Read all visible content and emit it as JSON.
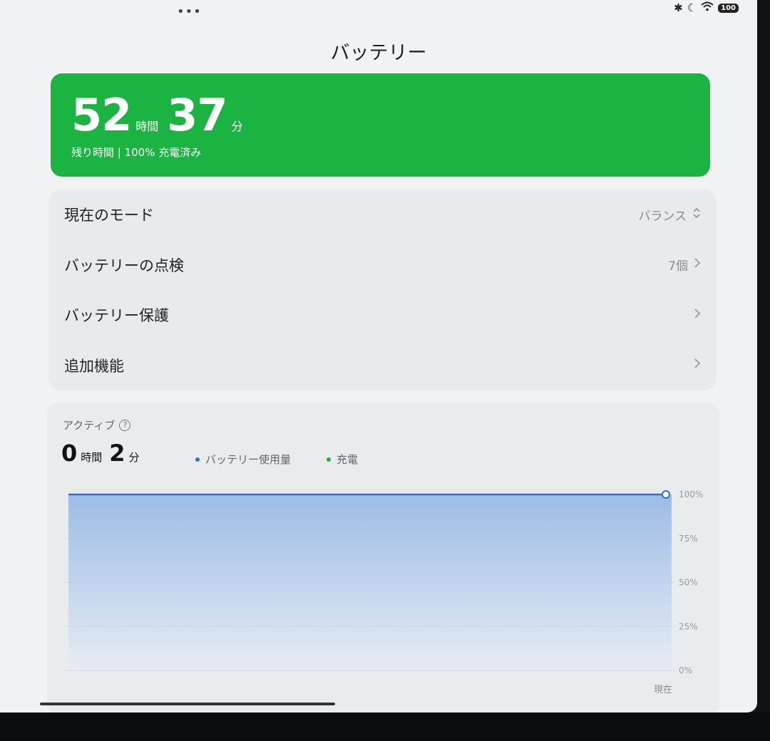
{
  "status": {
    "dots": "•••",
    "battery_level": "100"
  },
  "title": "バッテリー",
  "battery_card": {
    "hours": "52",
    "hours_unit": "時間",
    "minutes": "37",
    "minutes_unit": "分",
    "subtitle": "残り時間 | 100% 充電済み",
    "color": "#1bb341"
  },
  "settings": [
    {
      "label": "現在のモード",
      "value": "バランス",
      "icon": "up-down-chevron-icon"
    },
    {
      "label": "バッテリーの点検",
      "value": "7個",
      "icon": "chevron-right-icon"
    },
    {
      "label": "バッテリー保護",
      "value": "",
      "icon": "chevron-right-icon"
    },
    {
      "label": "追加機能",
      "value": "",
      "icon": "chevron-right-icon"
    }
  ],
  "active": {
    "label": "アクティブ",
    "hours": "0",
    "hours_unit": "時間",
    "minutes": "2",
    "minutes_unit": "分",
    "legend": [
      {
        "name": "バッテリー使用量",
        "color": "#2f6fd6"
      },
      {
        "name": "充電",
        "color": "#1bb341"
      }
    ]
  },
  "chart_data": {
    "type": "area",
    "x": [
      "",
      "現在"
    ],
    "series": [
      {
        "values": [
          100,
          100
        ]
      }
    ],
    "ylim": [
      0,
      100
    ],
    "y_ticks": [
      "100%",
      "75%",
      "50%",
      "25%",
      "0%"
    ],
    "x_tick_label": "現在",
    "grid": true
  }
}
